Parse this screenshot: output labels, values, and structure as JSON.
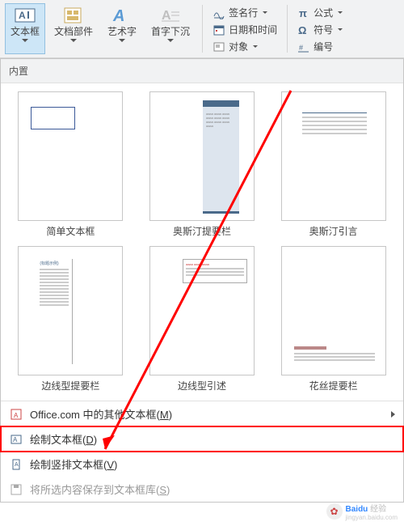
{
  "ribbon": {
    "textbox": "文本框",
    "doc_parts": "文档部件",
    "wordart": "艺术字",
    "dropcap": "首字下沉",
    "signature": "签名行",
    "datetime": "日期和时间",
    "object": "对象",
    "equation": "公式",
    "symbol": "符号",
    "number": "编号"
  },
  "panel": {
    "builtin_header": "内置",
    "thumbs": [
      {
        "label": "简单文本框"
      },
      {
        "label": "奥斯汀提要栏"
      },
      {
        "label": "奥斯汀引言"
      },
      {
        "label": "边线型提要栏"
      },
      {
        "label": "边线型引述"
      },
      {
        "label": "花丝提要栏"
      }
    ]
  },
  "menu": {
    "more_office": "Office.com 中的其他文本框(",
    "more_office_key": "M",
    "more_office_end": ")",
    "draw_tb": "绘制文本框(",
    "draw_tb_key": "D",
    "draw_tb_end": ")",
    "draw_vtb": "绘制竖排文本框(",
    "draw_vtb_key": "V",
    "draw_vtb_end": ")",
    "save_to_gallery": "将所选内容保存到文本框库(",
    "save_key": "S",
    "save_end": ")"
  },
  "watermark": {
    "brand": "Baidu",
    "sub": "经验",
    "sub2": "jingyan.baidu.com"
  }
}
